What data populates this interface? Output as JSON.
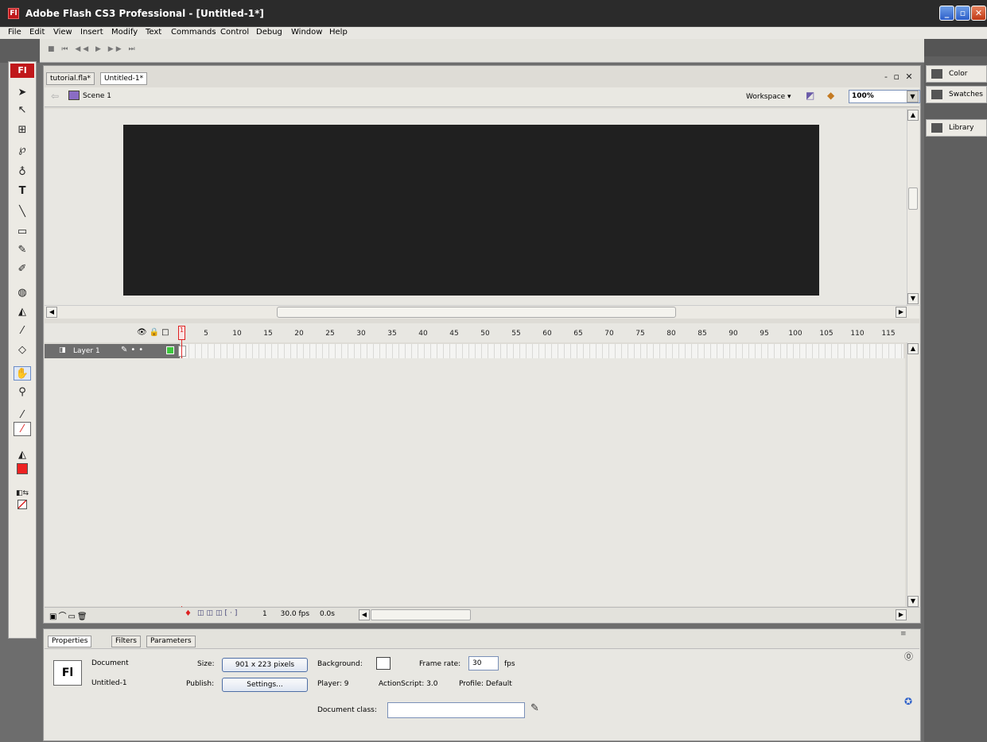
{
  "window": {
    "title": "Adobe Flash CS3 Professional - [Untitled-1*]",
    "app_badge": "Fl",
    "buttons": {
      "minimize": "_",
      "restore": "▫",
      "close": "✕"
    }
  },
  "menu": [
    "File",
    "Edit",
    "View",
    "Insert",
    "Modify",
    "Text",
    "Commands",
    "Control",
    "Debug",
    "Window",
    "Help"
  ],
  "controller": {
    "buttons": "■ ⏮ ◀◀ ▶ ▶▶ ⏭"
  },
  "tools": {
    "badge": "Fl"
  },
  "document": {
    "tabs": [
      "tutorial.fla*",
      "Untitled-1*"
    ],
    "window_controls": "- ▫ ✕",
    "scene": "Scene 1",
    "workspace": "Workspace ▾",
    "zoom": "100%",
    "stage_color": "#202020"
  },
  "timeline": {
    "ticks": [
      "5",
      "10",
      "15",
      "20",
      "25",
      "30",
      "35",
      "40",
      "45",
      "50",
      "55",
      "60",
      "65",
      "70",
      "75",
      "80",
      "85",
      "90",
      "95",
      "100",
      "105",
      "110",
      "115"
    ],
    "playhead": "1",
    "layer": "Layer 1",
    "current_frame": "1",
    "fps": "30.0 fps",
    "time": "0.0s"
  },
  "properties": {
    "tabs": [
      "Properties",
      "Filters",
      "Parameters"
    ],
    "doc_type": "Document",
    "doc_name": "Untitled-1",
    "size_label": "Size:",
    "size_value": "901 x 223 pixels",
    "publish_label": "Publish:",
    "settings_button": "Settings...",
    "background_label": "Background:",
    "framerate_label": "Frame rate:",
    "framerate_value": "30",
    "fps_unit": "fps",
    "player": "Player: 9",
    "actionscript": "ActionScript: 3.0",
    "profile": "Profile: Default",
    "docclass_label": "Document class:"
  },
  "right_panels": [
    "Color",
    "Swatches",
    "Library"
  ]
}
